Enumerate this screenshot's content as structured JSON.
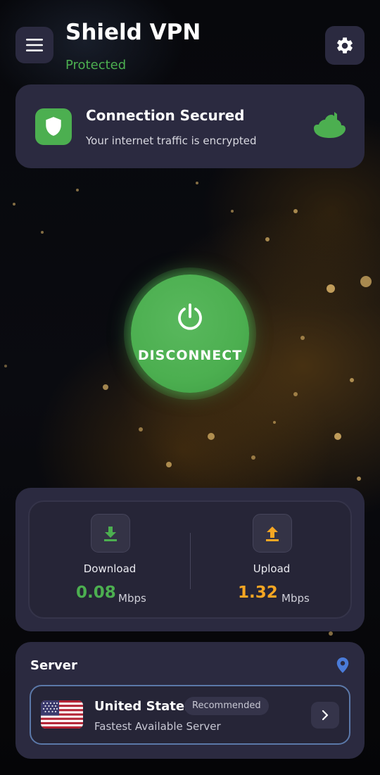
{
  "header": {
    "title": "Shield VPN",
    "status": "Protected",
    "menu_icon": "hamburger-menu-icon",
    "settings_icon": "gear-icon"
  },
  "connection": {
    "title": "Connection Secured",
    "subtitle": "Your internet traffic is encrypted",
    "shield_icon": "shield-icon",
    "status_icon": "cloud-icon"
  },
  "power": {
    "label": "DISCONNECT",
    "icon": "power-icon"
  },
  "speed": {
    "download": {
      "label": "Download",
      "value": "0.08",
      "unit": "Mbps",
      "icon": "download-arrow-icon"
    },
    "upload": {
      "label": "Upload",
      "value": "1.32",
      "unit": "Mbps",
      "icon": "upload-arrow-icon"
    }
  },
  "server": {
    "title": "Server",
    "country": "United States",
    "badge": "Recommended",
    "subtitle": "Fastest Available Server",
    "flag_icon": "us-flag-icon",
    "pin_icon": "location-pin-icon",
    "chevron_icon": "chevron-right-icon"
  },
  "colors": {
    "accent_green": "#4caf50",
    "accent_orange": "#f5a623",
    "card_bg": "#2b2a40",
    "pin_blue": "#4a7bd8"
  }
}
